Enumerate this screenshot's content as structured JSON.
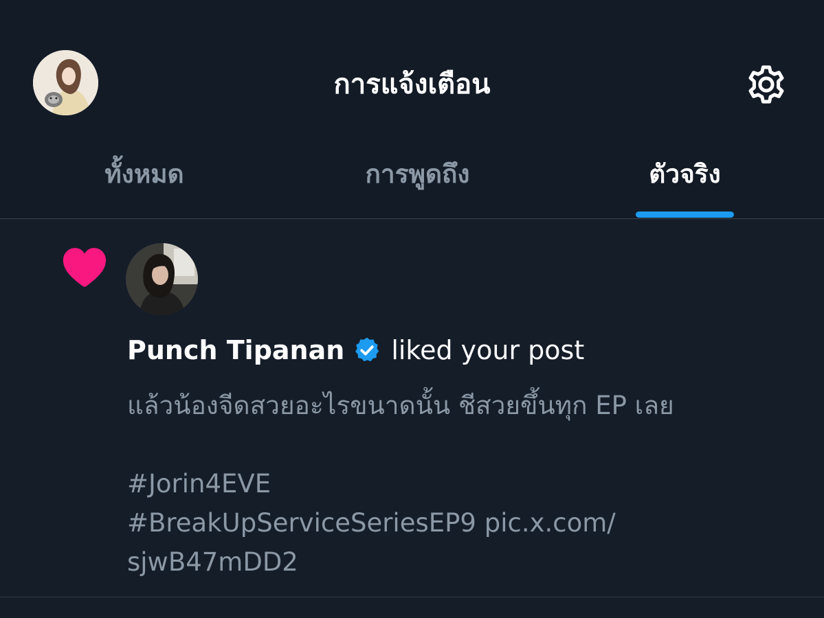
{
  "header": {
    "title": "การแจ้งเตือน",
    "avatar_icon": "profile-avatar",
    "settings_icon": "gear-icon"
  },
  "tabs": [
    {
      "label": "ทั้งหมด",
      "active": false
    },
    {
      "label": "การพูดถึง",
      "active": false
    },
    {
      "label": "ตัวจริง",
      "active": true
    }
  ],
  "notification": {
    "icon": "heart-icon",
    "user_name": "Punch Tipanan",
    "verified": true,
    "action": "liked your post",
    "post_lines": [
      "แล้วน้องจีดสวยอะไรขนาดนั้น ชีสวยขึ้นทุก EP เลย",
      "#Jorin4EVE",
      "#BreakUpServiceSeriesEP9 pic.x.com/",
      "sjwB47mDD2"
    ]
  },
  "colors": {
    "background": "#151d29",
    "accent": "#1d9bf0",
    "heart": "#f91880",
    "muted_text": "#8b98a5"
  }
}
